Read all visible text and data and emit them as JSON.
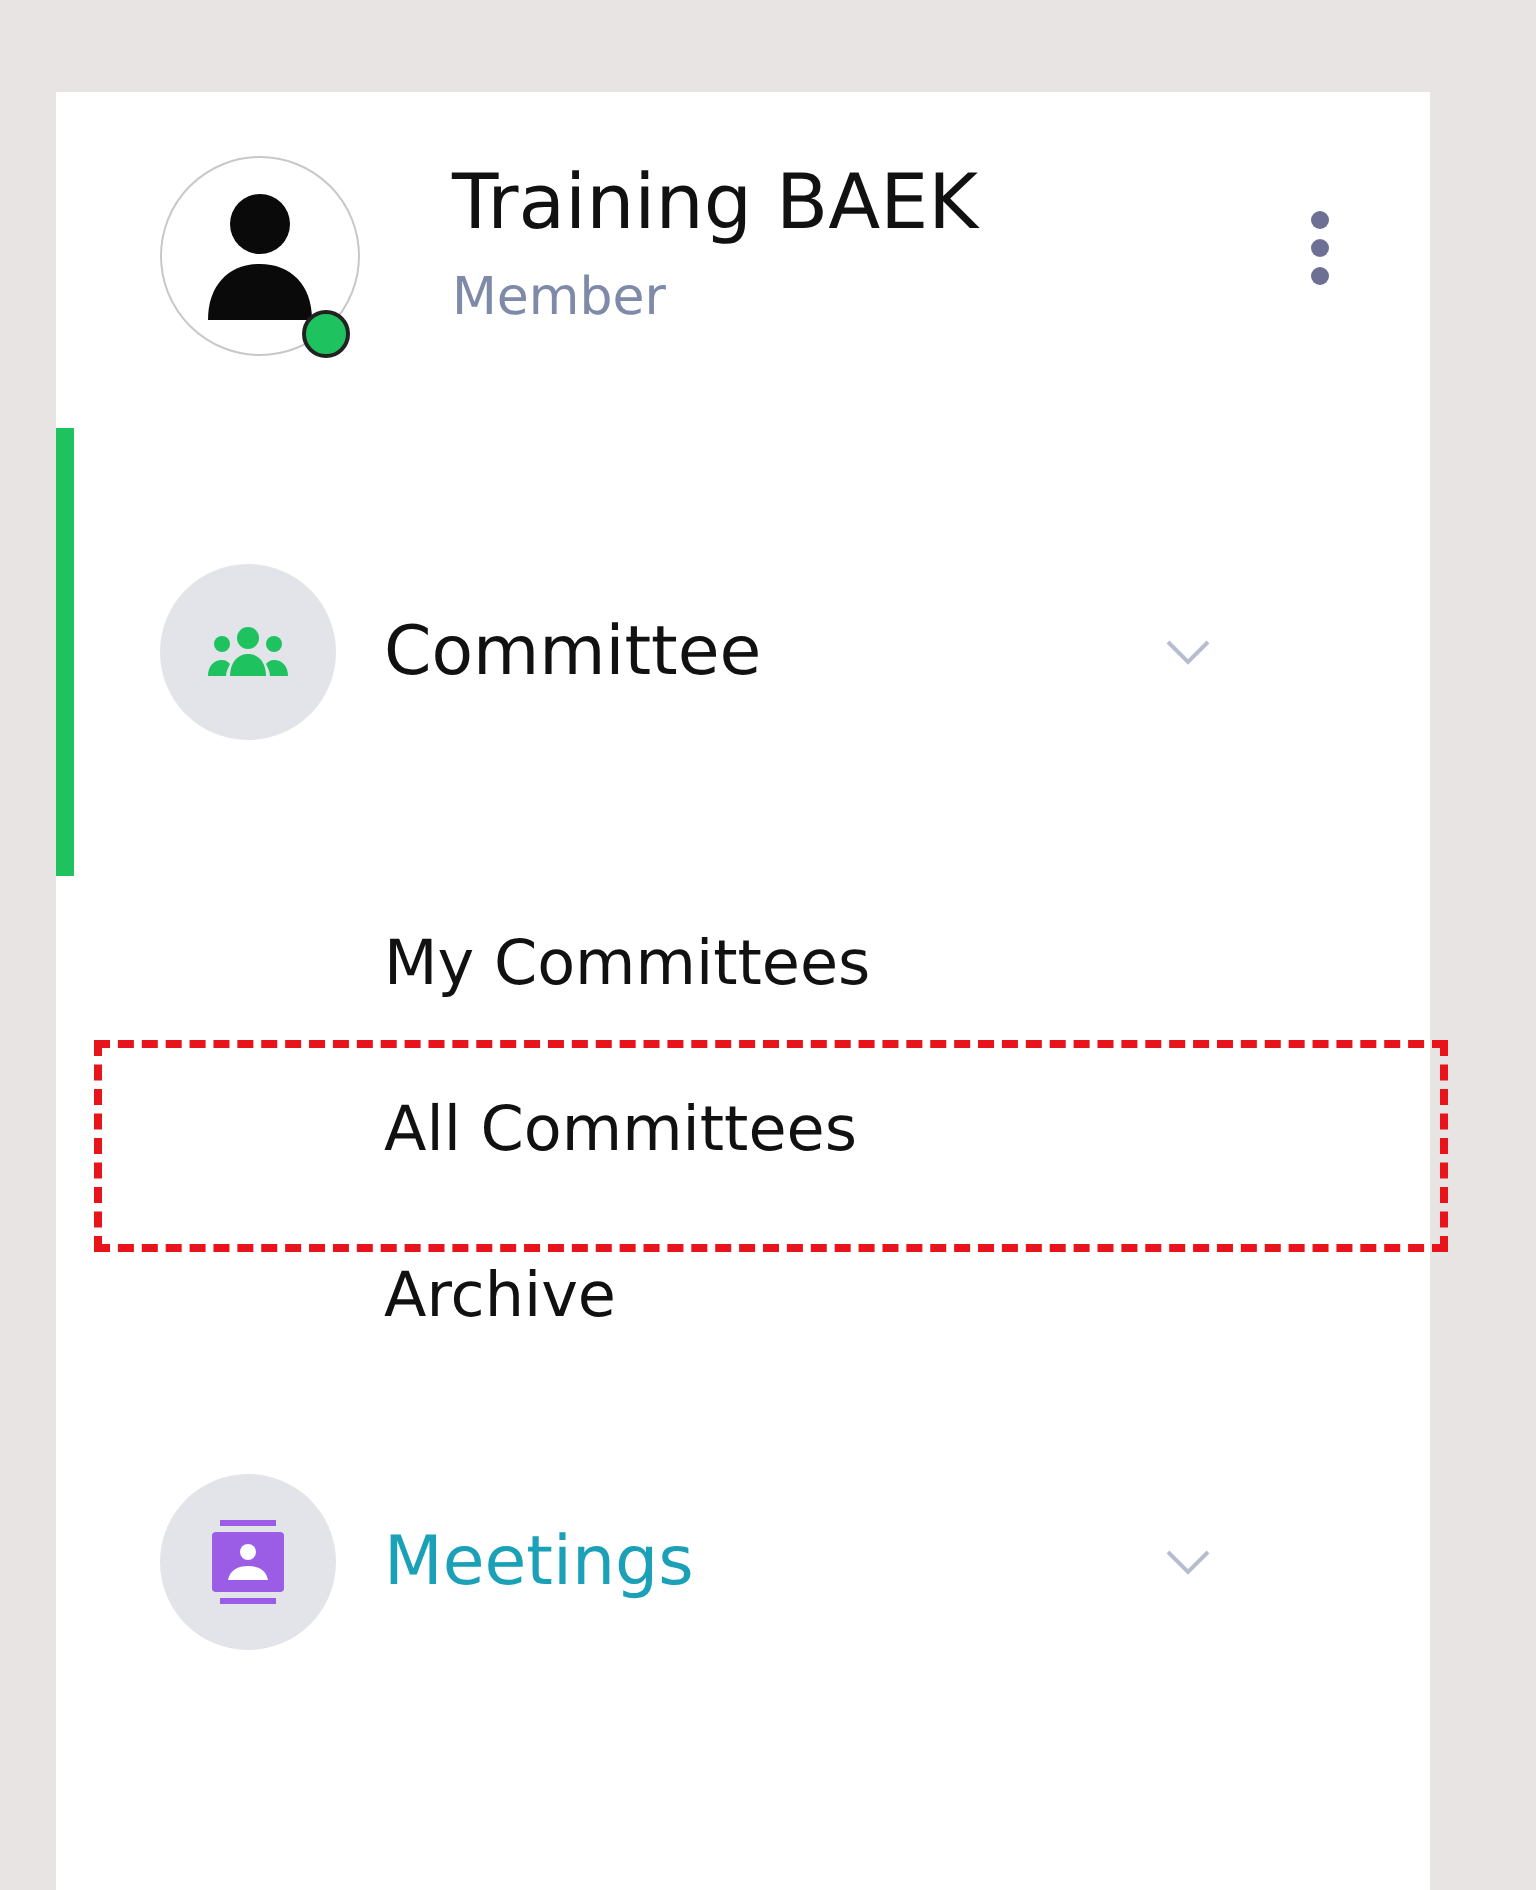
{
  "profile": {
    "name": "Training BAEK",
    "role": "Member",
    "online": true
  },
  "nav": [
    {
      "kind": "committee",
      "label": "Committee",
      "selected": true,
      "expanded": true,
      "children": [
        {
          "label": "My Committees",
          "highlighted": false
        },
        {
          "label": "All Committees",
          "highlighted": true
        },
        {
          "label": "Archive",
          "highlighted": false
        }
      ]
    },
    {
      "kind": "meetings",
      "label": "Meetings",
      "selected": false,
      "expanded": false
    }
  ]
}
